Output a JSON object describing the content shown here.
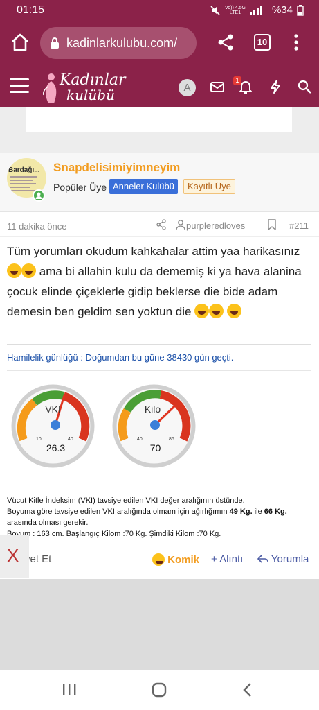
{
  "status": {
    "time": "01:15",
    "battery": "%34",
    "net_top": "Vo)) 4.5G",
    "net_bottom": "LTE1"
  },
  "browser": {
    "url": "kadinlarkulubu.com/",
    "tabs_count": "10"
  },
  "site": {
    "logo_line1": "Kadınlar",
    "logo_line2": "kulübü",
    "avatar_letter": "A",
    "alert_count": "1"
  },
  "post": {
    "avatar_text": "Bardağı...",
    "username": "Snapdelisimiyimneyim",
    "user_title": "Popüler Üye",
    "banner_primary": "Anneler Kulübü",
    "banner_secondary": "Kayıtlı Üye",
    "time": "11 dakika önce",
    "quoted_user": "purpleredloves",
    "post_number": "#211",
    "body_part1": "Tüm yorumları okudum kahkahalar attim yaa harikasınız",
    "body_part2": "ama bi allahin kulu da dememiş ki ya hava alanina çocuk elinde çiçeklerle gidip beklerse die bide adam demesin ben geldim sen yoktun die",
    "signature": "Hamilelik günlüğü : Doğumdan bu güne 38430 gün geçti.",
    "gauge_vki": {
      "label": "VKI",
      "value": "26.3",
      "min": "10",
      "max": "40"
    },
    "gauge_kilo": {
      "label": "Kilo",
      "value": "70",
      "min": "40",
      "max": "86"
    },
    "bmi_line1": "Vücut Kitle İndeksim (VKI) tavsiye edilen VKI değer aralığının üstünde.",
    "bmi_line2_a": "Boyuma göre tavsiye edilen VKI aralığında olmam için ağırlığımın",
    "bmi_line2_b": "49 Kg.",
    "bmi_line2_c": "ile",
    "bmi_line2_d": "66 Kg.",
    "bmi_line3": "arasında olması gerekir.",
    "bmi_line4": "Boyum : 163 cm. Başlangıç Kilom :70 Kg. Şimdiki Kilom :70 Kg."
  },
  "actions": {
    "like_partial": "yet Et",
    "reaction": "Komik",
    "quote": "+ Alıntı",
    "reply": "Yorumla",
    "close": "X"
  },
  "colors": {
    "brand": "#8b2249",
    "username": "#f29c1f",
    "banner_blue": "#3a6fd9"
  }
}
